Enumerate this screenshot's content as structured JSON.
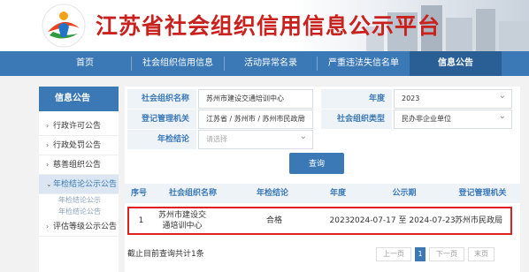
{
  "site": {
    "title": "江苏省社会组织信用信息公示平台"
  },
  "nav": {
    "items": [
      {
        "label": "首页"
      },
      {
        "label": "社会组织信用信息"
      },
      {
        "label": "活动异常名录"
      },
      {
        "label": "严重违法失信名单"
      },
      {
        "label": "信息公告"
      }
    ]
  },
  "sidebar": {
    "title": "信息公告",
    "items": [
      {
        "label": "行政许可公告"
      },
      {
        "label": "行政处罚公告"
      },
      {
        "label": "慈善组织公告"
      },
      {
        "label": "年检结论公示公告"
      },
      {
        "label": "评估等级公示公告"
      }
    ],
    "subitems": [
      {
        "label": "年检结论公示"
      },
      {
        "label": "年检结论公告"
      }
    ]
  },
  "form": {
    "org_name_label": "社会组织名称",
    "org_name_value": "苏州市建设交通培训中心",
    "year_label": "年度",
    "year_value": "2023",
    "registry_label": "登记管理机关",
    "registry_value": "江苏省 / 苏州市 / 苏州市民政局",
    "org_type_label": "社会组织类型",
    "org_type_value": "民办非企业单位",
    "conclusion_label": "年检结论",
    "conclusion_placeholder": "请选择",
    "query_label": "查询"
  },
  "table": {
    "headers": [
      "序号",
      "社会组织名称",
      "年检结论",
      "年度",
      "公示期",
      "登记管理机关"
    ],
    "rows": [
      {
        "index": "1",
        "name": "苏州市建设交通培训中心",
        "conclusion": "合格",
        "year": "2023",
        "period": "2024-07-17 至 2024-07-23",
        "authority": "苏州市民政局"
      }
    ]
  },
  "summary": {
    "total_text": "截止目前查询共计1条"
  },
  "pager": {
    "prev": "上一页",
    "current": "1",
    "next": "下一页",
    "last": "末页"
  },
  "colors": {
    "brand": "#3a78b6",
    "title_red": "#c9211e",
    "highlight_red": "#e02020"
  }
}
